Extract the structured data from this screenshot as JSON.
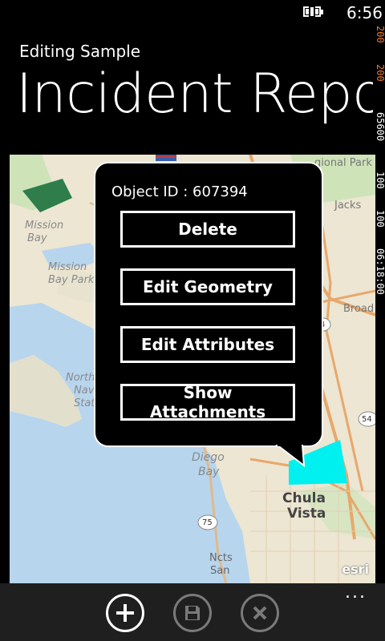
{
  "status": {
    "time": "6:56"
  },
  "debug_counters": [
    "200",
    "200",
    "65600",
    "100",
    "100",
    "06:18:00"
  ],
  "app": {
    "title": "Editing Sample"
  },
  "page": {
    "title": "Incident Repor"
  },
  "map": {
    "labels": [
      "Mission",
      "Bay",
      "Mission",
      "Bay Park",
      "North",
      "Nav",
      "Stat",
      "Diego",
      "Bay",
      "Chula",
      "Vista",
      "Ncts",
      "San",
      "Jacks",
      "gional Park",
      "Broad",
      "4",
      "54",
      "75"
    ],
    "attribution": "esri"
  },
  "callout": {
    "object_id_label": "Object ID :",
    "object_id_value": "607394",
    "buttons": [
      "Delete",
      "Edit Geometry",
      "Edit Attributes",
      "Show Attachments"
    ]
  },
  "appbar": {
    "buttons": [
      {
        "icon": "add-icon",
        "enabled": true
      },
      {
        "icon": "save-icon",
        "enabled": false
      },
      {
        "icon": "cancel-icon",
        "enabled": false
      }
    ],
    "more": "..."
  }
}
